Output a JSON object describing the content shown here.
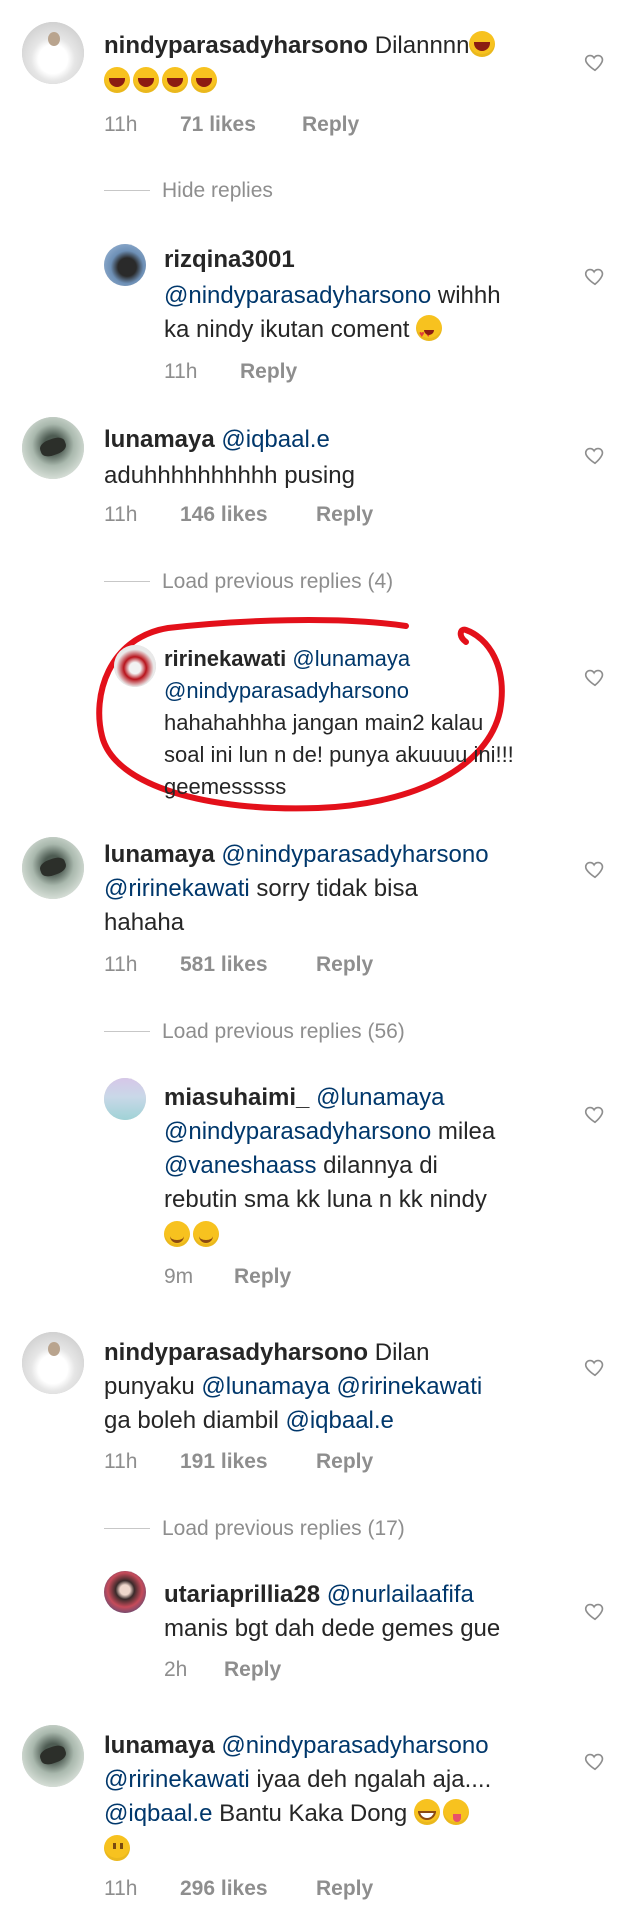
{
  "comments": [
    {
      "username": "nindyparasadyharsono",
      "text_line1_plain": "Dilannnn",
      "time": "11h",
      "likes": "71 likes",
      "reply": "Reply",
      "toggle_label": "Hide replies"
    },
    {
      "username": "rizqina3001",
      "mention": "@nindyparasadyharsono",
      "text_line1_after": "wihhh",
      "text_line2": "ka nindy ikutan coment",
      "time": "11h",
      "reply": "Reply"
    },
    {
      "username": "lunamaya",
      "mention": "@iqbaal.e",
      "text_line2": "aduhhhhhhhhhh pusing",
      "time": "11h",
      "likes": "146 likes",
      "reply": "Reply",
      "toggle_label": "Load previous replies (4)"
    },
    {
      "username": "ririnekawati",
      "mention1": "@lunamaya",
      "mention2": "@nindyparasadyharsono",
      "text_line3": "hahahahhha jangan main2 kalau",
      "text_line4": "soal ini lun n de! punya akuuuu ini!!!",
      "text_line5": "geemesssss"
    },
    {
      "username": "lunamaya",
      "mention1": "@nindyparasadyharsono",
      "mention2": "@ririnekawati",
      "text_line2_after": "sorry tidak bisa",
      "text_line3": "hahaha",
      "time": "11h",
      "likes": "581 likes",
      "reply": "Reply",
      "toggle_label": "Load previous replies (56)"
    },
    {
      "username": "miasuhaimi_",
      "mention1": "@lunamaya",
      "mention2": "@nindyparasadyharsono",
      "text_line2_after": "milea",
      "mention3": "@vaneshaass",
      "text_line3_after": "dilannya di",
      "text_line4": "rebutin sma kk luna n kk nindy",
      "time": "9m",
      "reply": "Reply"
    },
    {
      "username": "nindyparasadyharsono",
      "text_line1_after": "Dilan",
      "text_line2_before": "punyaku",
      "mention1": "@lunamaya",
      "mention2": "@ririnekawati",
      "text_line3_before": "ga boleh diambil",
      "mention3": "@iqbaal.e",
      "time": "11h",
      "likes": "191 likes",
      "reply": "Reply",
      "toggle_label": "Load previous replies (17)"
    },
    {
      "username": "utariaprillia28",
      "mention": "@nurlailaafifa",
      "text_line2": "manis bgt dah dede gemes gue",
      "time": "2h",
      "reply": "Reply"
    },
    {
      "username": "lunamaya",
      "mention1": "@nindyparasadyharsono",
      "mention2": "@ririnekawati",
      "text_line2_after": "iyaa deh ngalah aja....",
      "mention3": "@iqbaal.e",
      "text_line3_after": "Bantu Kaka Dong",
      "time": "11h",
      "likes": "296 likes",
      "reply": "Reply"
    }
  ],
  "colors": {
    "username": "#262626",
    "mention": "#00376b",
    "meta": "#8e8e8e",
    "highlight_circle": "#e3101a"
  },
  "icons": {
    "like": "heart-outline-icon"
  }
}
